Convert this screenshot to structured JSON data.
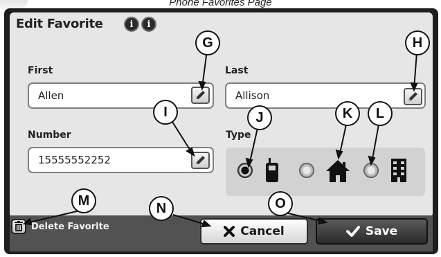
{
  "caption": "Phone Favorites Page",
  "dialog": {
    "title": "Edit Favorite",
    "help_icons": [
      "info-icon",
      "info-icon"
    ]
  },
  "form": {
    "first": {
      "label": "First",
      "value": "Allen"
    },
    "last": {
      "label": "Last",
      "value": "Allison"
    },
    "number": {
      "label": "Number",
      "value": "15555552252"
    },
    "type": {
      "label": "Type",
      "options": [
        {
          "icon": "mobile-phone-icon",
          "selected": true
        },
        {
          "icon": "home-icon",
          "selected": false
        },
        {
          "icon": "office-building-icon",
          "selected": false
        }
      ]
    }
  },
  "footer": {
    "delete_label": "Delete Favorite",
    "cancel_label": "Cancel",
    "save_label": "Save"
  },
  "callouts": [
    "G",
    "H",
    "I",
    "J",
    "K",
    "L",
    "M",
    "N",
    "O"
  ],
  "colors": {
    "panel": "#e6e6e6",
    "bar": "#525252",
    "frame": "#1e1e1e",
    "save_button": "#3a3a3a"
  }
}
